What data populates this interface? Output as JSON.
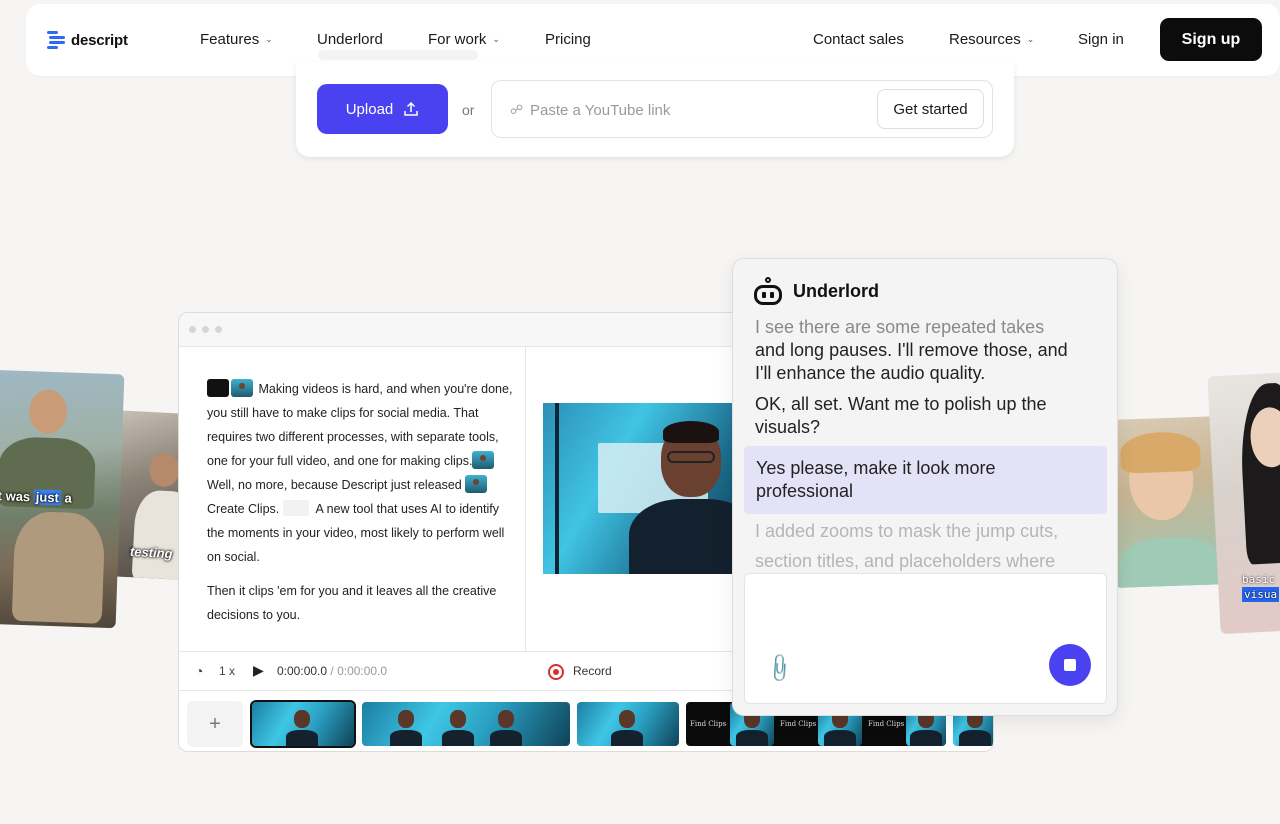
{
  "nav": {
    "brand": "descript",
    "items": [
      {
        "label": "Features",
        "dropdown": true
      },
      {
        "label": "Underlord",
        "dropdown": false
      },
      {
        "label": "For work",
        "dropdown": true
      },
      {
        "label": "Pricing",
        "dropdown": false
      }
    ],
    "right_items": [
      {
        "label": "Contact sales",
        "dropdown": false
      },
      {
        "label": "Resources",
        "dropdown": true
      },
      {
        "label": "Sign in",
        "dropdown": false
      }
    ],
    "signup_label": "Sign up"
  },
  "upload": {
    "upload_label": "Upload",
    "or_label": "or",
    "youtube_placeholder": "Paste a YouTube link",
    "youtube_value": "",
    "get_started_label": "Get started"
  },
  "thumbnails": {
    "left_caption_pre": "It was ",
    "left_caption_highlight": "just",
    "left_caption_post": " a",
    "left_back_caption": "testing",
    "right_caption_line1": "basic",
    "right_caption_line2": "visua"
  },
  "editor": {
    "script_paragraph1": {
      "part1": "Making videos is hard, and when you're done, you still have to make clips for social media. That requires two different processes, with separate tools, one for your full video, and one for making clips.",
      "part2": "Well, no more, because Descript just released",
      "part3": "Create Clips.",
      "part4": "A new tool that uses AI to identify the moments in your video, most likely to perform well on social."
    },
    "script_paragraph2": "Then it clips 'em for you and it leaves all the creative decisions to you.",
    "transport": {
      "speed": "1 x",
      "current_time": "0:00:00.0",
      "separator": " / ",
      "total_time": "0:00:00.0",
      "record_label": "Record"
    },
    "timeline": {
      "add_label": "+",
      "find_clips_label": "Find Clips"
    }
  },
  "underlord": {
    "title": "Underlord",
    "messages": [
      "I see there are some repeated takes",
      "and long pauses. I'll remove those, and I'll enhance the audio quality.",
      "OK, all set. Want me to polish up the visuals?"
    ],
    "user_message": "Yes please, make it look more professional",
    "pending_message": "I added zooms to mask the jump cuts, section titles, and placeholders where",
    "input_placeholder": ""
  },
  "colors": {
    "accent": "#4a41f0",
    "brand_blue": "#2e6bf3",
    "user_bubble": "#e4e2f7",
    "record_red": "#d92d2d"
  },
  "icons": [
    "descript-logo-icon",
    "chevron-down-icon",
    "upload-icon",
    "link-icon",
    "robot-icon",
    "paperclip-icon",
    "stop-icon",
    "speed-icon",
    "play-icon",
    "record-icon",
    "plus-icon"
  ]
}
